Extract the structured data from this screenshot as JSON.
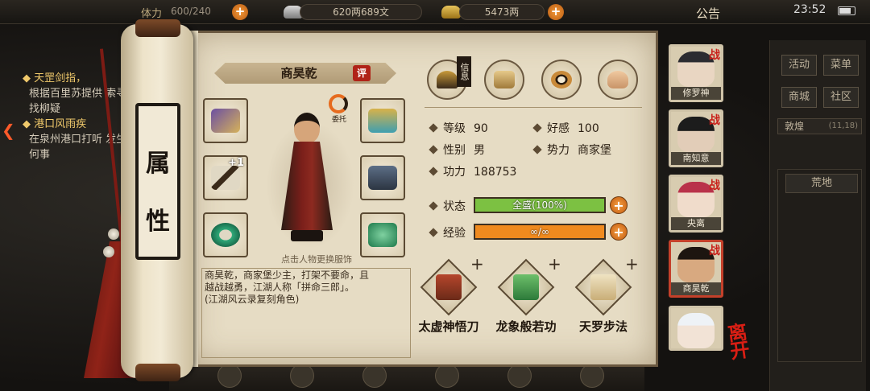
{
  "topbar": {
    "stamina": "600/240",
    "silver": "620两689文",
    "gold": "5473两",
    "announcement": "公告",
    "time": "23:52",
    "stamina_label": "体力"
  },
  "quests": [
    {
      "title": "天罡剑指，",
      "desc": "根据百里苏提供 索寻找柳疑"
    },
    {
      "title": "港口风雨疾",
      "desc": "在泉州港口打听 发生何事"
    }
  ],
  "side_menu": {
    "buttons": [
      "活动",
      "菜单",
      "商城",
      "社区"
    ],
    "location": "敦煌",
    "coords": "(11,18)",
    "area": "荒地"
  },
  "scroll_title": [
    "属",
    "性"
  ],
  "character": {
    "name": "商昊乾",
    "rate_badge": "评",
    "entrust_label": "委托",
    "hint": "点击人物更换服饰",
    "bio_line1": "商昊乾，商家堡少主，打架不要命，且",
    "bio_line2": "越战越勇，江湖人称「拼命三郎」。",
    "bio_line3": "(江湖风云录复刻角色)",
    "weapon_plus": "+1"
  },
  "tabs": {
    "info_tag": "信息"
  },
  "stats": {
    "level_label": "等级",
    "level": "90",
    "favor_label": "好感",
    "favor": "100",
    "gender_label": "性别",
    "gender": "男",
    "faction_label": "势力",
    "faction": "商家堡",
    "power_label": "功力",
    "power": "188753"
  },
  "bars": {
    "state_label": "状态",
    "state_text": "全盛(100%)",
    "state_fill": 1.0,
    "exp_label": "经验",
    "exp_text": "∞/∞",
    "exp_fill": 1.0,
    "plus": "+"
  },
  "skills": [
    {
      "name": "太虚神悟刀",
      "plus": "+"
    },
    {
      "name": "龙象般若功",
      "plus": "+"
    },
    {
      "name": "天罗步法",
      "plus": "+"
    }
  ],
  "party": [
    {
      "name": "修罗神",
      "tag": "战"
    },
    {
      "name": "南知意",
      "tag": "战"
    },
    {
      "name": "央离",
      "tag": "战"
    },
    {
      "name": "商昊乾",
      "tag": "战"
    },
    {
      "name": "",
      "tag": ""
    }
  ],
  "leave_label": "离开",
  "colors": {
    "state_bar": "#7cc142",
    "exp_bar": "#f08a1e",
    "accent_red": "#c8201a"
  }
}
